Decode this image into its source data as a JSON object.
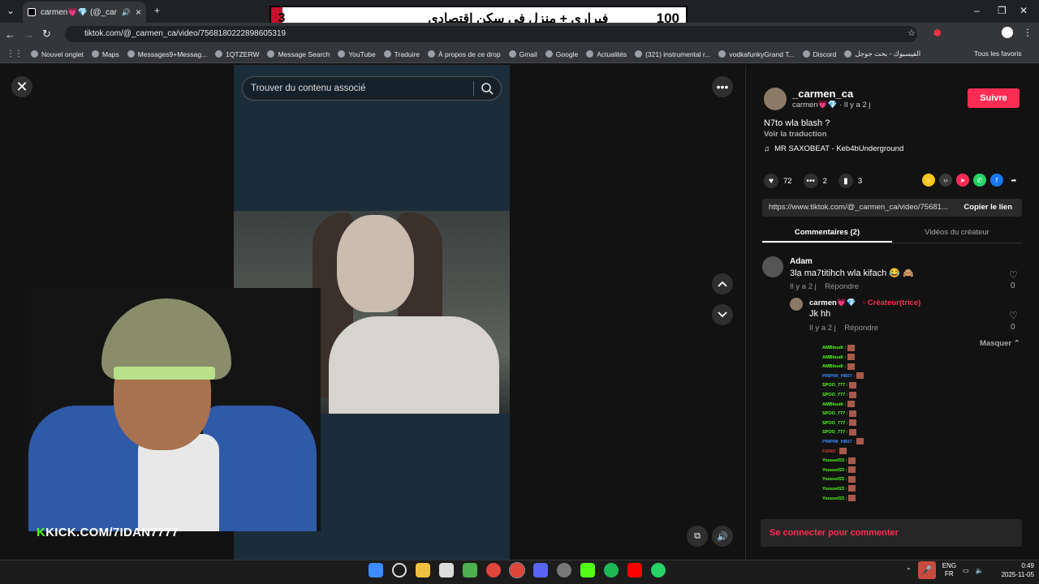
{
  "browser": {
    "tab_title": "carmen💗💎 (@_carmen_c",
    "url": "tiktok.com/@_carmen_ca/video/7568180222898605319",
    "bookmarks": [
      "Nouvel onglet",
      "Maps",
      "Messages9+Messag...",
      "1QTZERW",
      "Message Search",
      "YouTube",
      "Traduire",
      "À propos de ce drop",
      "Gmail",
      "Google",
      "Actualités",
      "(321) instrumental r...",
      "vodkafunkyGrand T...",
      "Discord",
      "الفيسبوك - بحث جوجل"
    ],
    "all_bookmarks": "Tous les favoris"
  },
  "banner": {
    "left_num": "3",
    "text": "فيراري + منزل في سكن اقتصادي",
    "right_num": "100"
  },
  "player": {
    "search_placeholder": "Trouver du contenu associé"
  },
  "stream": {
    "kick_k": "K",
    "kick_text": "KICK.COM/7IDAN7777"
  },
  "panel": {
    "username": "_carmen_ca",
    "subline": "carmen💗💎 · Il y a 2 j",
    "follow": "Suivre",
    "caption": "N7to wla blash ?",
    "translate": "Voir la traduction",
    "music": "MR SAXOBEAT - Keb4bUnderground",
    "likes": "72",
    "comments": "2",
    "saves": "3",
    "link": "https://www.tiktok.com/@_carmen_ca/video/75681...",
    "copy_link": "Copier le lien",
    "tab_comments": "Commentaires (2)",
    "tab_videos": "Vidéos du créateur",
    "c1_user": "Adam",
    "c1_text": "3la ma7titihch wla kifach 😂 🙈",
    "c1_meta": "Il y a 2 j    Répondre",
    "c1_count": "0",
    "c2_user": "carmen💗💎",
    "c2_badge": "· Créateur(trice)",
    "c2_text": "Jk hh",
    "c2_meta": "Il y a 2 j    Répondre",
    "c2_count": "0",
    "hide": "Masquer ⌃",
    "login": "Se connecter pour commenter"
  },
  "chat": [
    {
      "name": "AMBIoudi",
      "color": "#53fc18"
    },
    {
      "name": "AMBIoudi",
      "color": "#53fc18"
    },
    {
      "name": "AMBIoudi",
      "color": "#53fc18"
    },
    {
      "name": "PINPIW_HB07",
      "color": "#3a8cff"
    },
    {
      "name": "SPOO_777",
      "color": "#53fc18"
    },
    {
      "name": "SPOO_777",
      "color": "#53fc18"
    },
    {
      "name": "AMBIoudi",
      "color": "#53fc18"
    },
    {
      "name": "SPOO_777",
      "color": "#53fc18"
    },
    {
      "name": "SPOO_777",
      "color": "#53fc18"
    },
    {
      "name": "SPOO_777",
      "color": "#53fc18"
    },
    {
      "name": "PINPIW_HB07",
      "color": "#3a8cff"
    },
    {
      "name": "FARID",
      "color": "#d43a3a"
    },
    {
      "name": "Youssef23",
      "color": "#53fc18"
    },
    {
      "name": "Youssef23",
      "color": "#53fc18"
    },
    {
      "name": "Youssef23",
      "color": "#53fc18"
    },
    {
      "name": "Youssef23",
      "color": "#53fc18"
    },
    {
      "name": "Youssef23",
      "color": "#53fc18"
    }
  ],
  "taskbar": {
    "lang1": "ENG",
    "lang2": "FR",
    "time": "0:49",
    "date": "2025-11-05"
  }
}
